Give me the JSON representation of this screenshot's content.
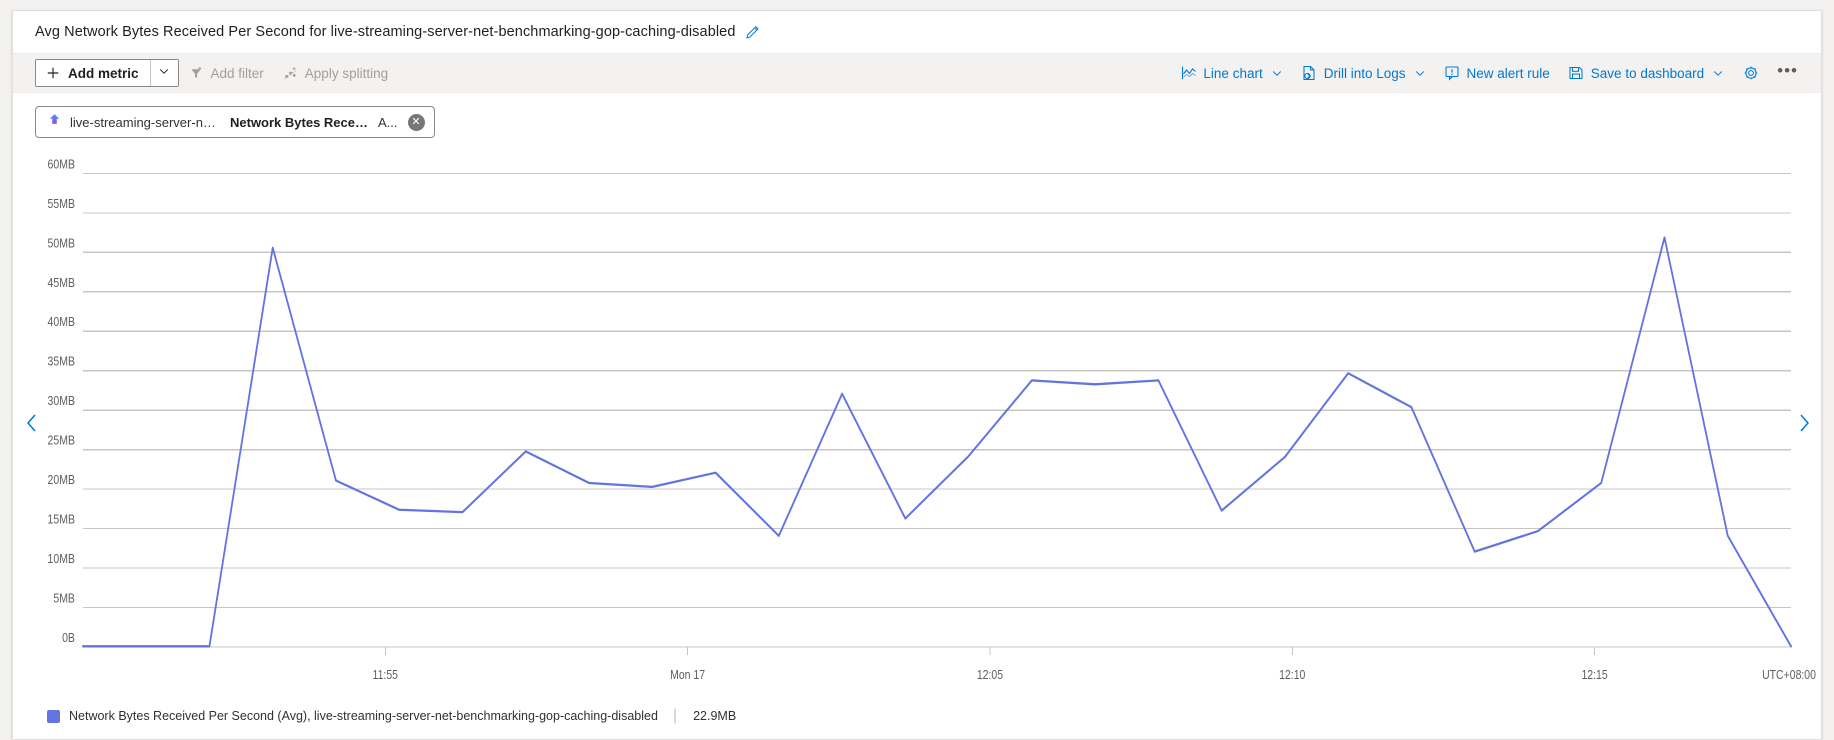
{
  "header": {
    "title": "Avg Network Bytes Received Per Second for live-streaming-server-net-benchmarking-gop-caching-disabled",
    "edit_icon": "pencil-icon"
  },
  "toolbar": {
    "add_metric_label": "Add metric",
    "add_metric_icon": "plus-icon",
    "add_metric_caret_icon": "chevron-down-icon",
    "add_filter_label": "Add filter",
    "add_filter_icon": "filter-add-icon",
    "apply_splitting_label": "Apply splitting",
    "apply_splitting_icon": "splitting-icon",
    "line_chart_label": "Line chart",
    "line_chart_icon": "line-chart-icon",
    "drill_into_logs_label": "Drill into Logs",
    "drill_into_logs_icon": "logs-icon",
    "new_alert_rule_label": "New alert rule",
    "new_alert_rule_icon": "alert-bell-icon",
    "save_to_dashboard_label": "Save to dashboard",
    "save_to_dashboard_icon": "save-disk-icon",
    "settings_icon": "gear-icon",
    "more_icon": "ellipsis-icon",
    "caret_icon": "chevron-down-icon"
  },
  "metric_chip": {
    "scope": "live-streaming-server-net-...",
    "metric": "Network Bytes Receive...",
    "aggregation": "A...",
    "close_icon": "close-circle-icon"
  },
  "navigation": {
    "prev_icon": "chevron-left-icon",
    "next_icon": "chevron-right-icon"
  },
  "legend": {
    "swatch_color": "#6374e0",
    "label": "Network Bytes Received Per Second (Avg), live-streaming-server-net-benchmarking-gop-caching-disabled",
    "separator": "|",
    "value": "22.9MB"
  },
  "colors": {
    "accent": "#0078d4",
    "series": "#6374e0",
    "grid": "#c8c6c4",
    "text": "#323130"
  },
  "chart_data": {
    "type": "line",
    "title": "Avg Network Bytes Received Per Second for live-streaming-server-net-benchmarking-gop-caching-disabled",
    "xlabel": "",
    "ylabel": "",
    "timezone_label": "UTC+08:00",
    "grid": true,
    "legend_position": "bottom",
    "ylim": [
      0,
      62
    ],
    "yunit": "MB",
    "ytick_labels": [
      "0B",
      "5MB",
      "10MB",
      "15MB",
      "20MB",
      "25MB",
      "30MB",
      "35MB",
      "40MB",
      "45MB",
      "50MB",
      "55MB",
      "60MB"
    ],
    "ytick_values": [
      0,
      5,
      10,
      15,
      20,
      25,
      30,
      35,
      40,
      45,
      50,
      55,
      60
    ],
    "xtick_labels": [
      "11:55",
      "Mon 17",
      "12:05",
      "12:10",
      "12:15"
    ],
    "xtick_positions": [
      0.177,
      0.354,
      0.531,
      0.708,
      0.885
    ],
    "series": [
      {
        "name": "Network Bytes Received Per Second (Avg), live-streaming-server-net-benchmarking-gop-caching-disabled",
        "color": "#6374e0",
        "current_value": "22.9MB",
        "x": [
          0,
          1,
          2,
          3,
          4,
          5,
          6,
          7,
          8,
          9,
          10,
          11,
          12,
          13,
          14,
          15,
          16,
          17,
          18,
          19,
          20,
          21,
          22,
          23,
          24,
          25,
          26,
          27
        ],
        "values": [
          0,
          0,
          0,
          50.5,
          21.0,
          17.3,
          17.0,
          24.7,
          20.7,
          20.2,
          22.0,
          14.0,
          32.0,
          16.2,
          24.1,
          33.7,
          33.2,
          33.7,
          17.2,
          24.0,
          34.6,
          30.3,
          12.0,
          14.6,
          20.7,
          51.8,
          14.0,
          0.0
        ]
      }
    ]
  }
}
